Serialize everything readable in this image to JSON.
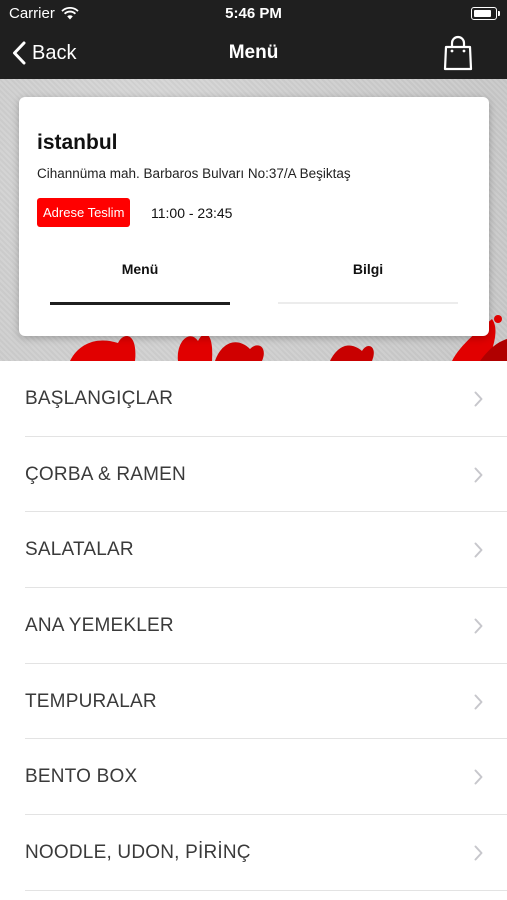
{
  "status_bar": {
    "carrier": "Carrier",
    "time": "5:46 PM"
  },
  "nav": {
    "back_label": "Back",
    "title": "Menü"
  },
  "restaurant": {
    "name": "istanbul",
    "address": "Cihannüma mah. Barbaros Bulvarı No:37/A Beşiktaş",
    "delivery_badge": "Adrese Teslim",
    "hours": "11:00 - 23:45"
  },
  "tabs": [
    {
      "label": "Menü",
      "active": true
    },
    {
      "label": "Bilgi",
      "active": false
    }
  ],
  "categories": [
    {
      "label": "BAŞLANGIÇLAR"
    },
    {
      "label": "ÇORBA & RAMEN"
    },
    {
      "label": "SALATALAR"
    },
    {
      "label": "ANA YEMEKLER"
    },
    {
      "label": "TEMPURALAR"
    },
    {
      "label": "BENTO BOX"
    },
    {
      "label": "NOODLE, UDON, PİRİNÇ"
    }
  ],
  "colors": {
    "navbar": "#1f1f1f",
    "badge": "#ff0000",
    "accent_splash": "#e10000"
  },
  "icons": {
    "back": "chevron-left-icon",
    "cart": "shopping-bag-icon",
    "wifi": "wifi-icon",
    "battery": "battery-icon",
    "row": "chevron-right-icon"
  }
}
